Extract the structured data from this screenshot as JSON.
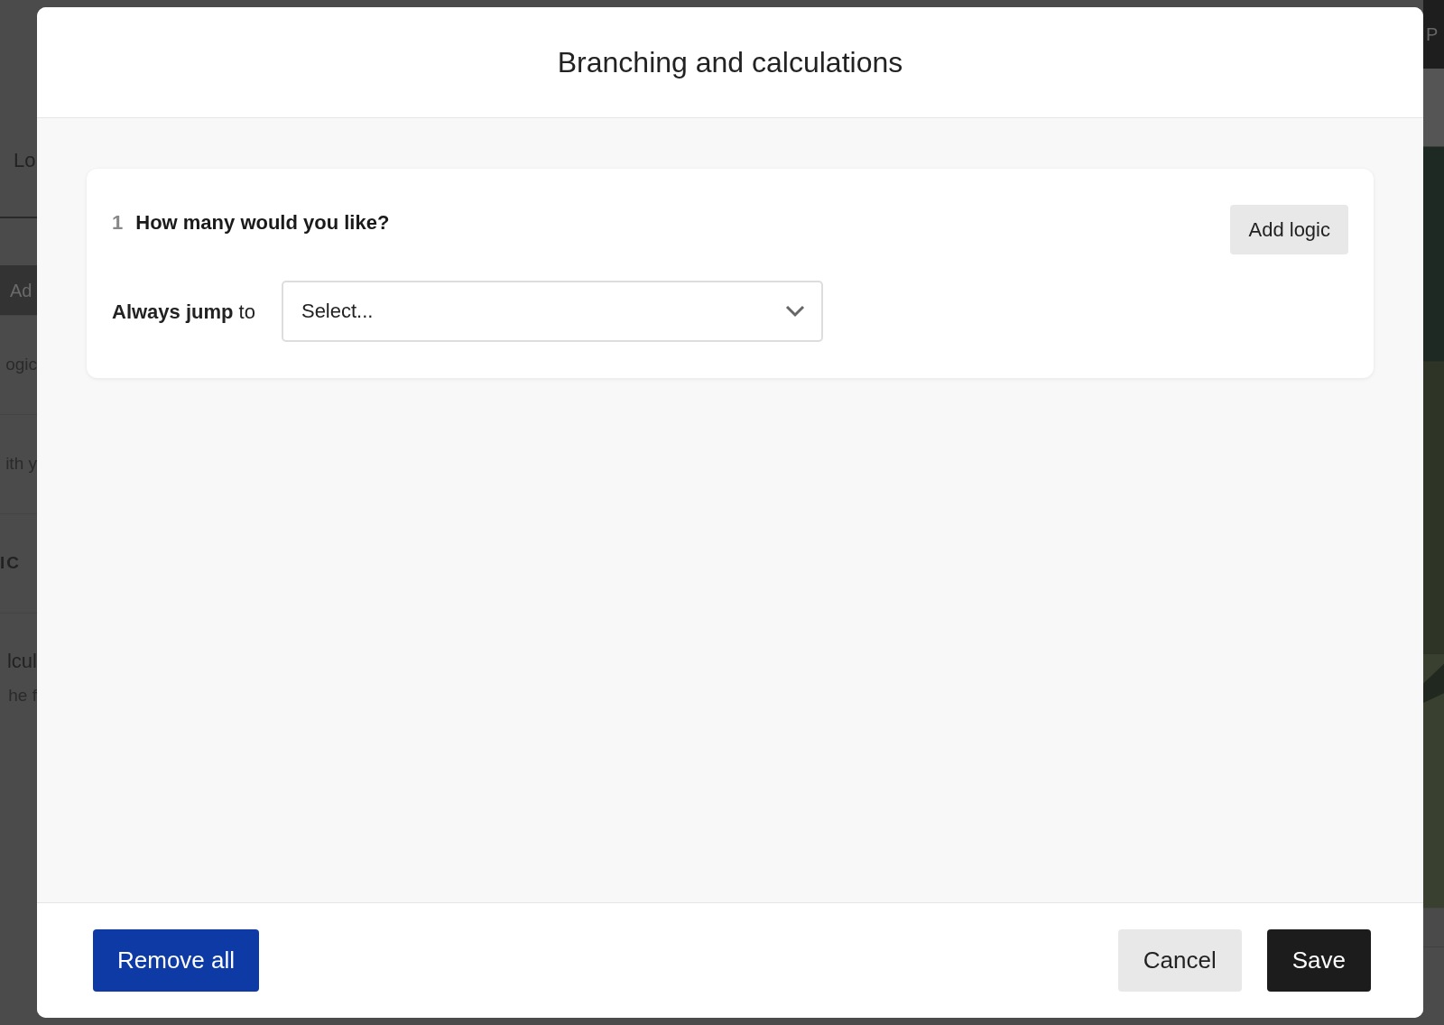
{
  "background": {
    "left_fragments": [
      {
        "text": "Lo",
        "kind": "tab"
      },
      {
        "text": "Ad",
        "kind": "button"
      },
      {
        "text": "ogic",
        "kind": "text"
      },
      {
        "text": "ith y",
        "kind": "text"
      },
      {
        "text": "IC",
        "kind": "heading"
      },
      {
        "text": "lcul",
        "kind": "title"
      },
      {
        "text": "he f",
        "kind": "text"
      }
    ],
    "right_fragment": "P"
  },
  "dialog": {
    "title": "Branching and calculations",
    "question": {
      "number": "1",
      "text": "How many would you like?",
      "add_button": "Add logic",
      "rule_label": "**Always jump** to",
      "select": {
        "placeholder": "Select..."
      }
    },
    "footer": {
      "remove_button": "Remove all",
      "cancel_button": "Cancel",
      "save_button": "Save"
    }
  }
}
